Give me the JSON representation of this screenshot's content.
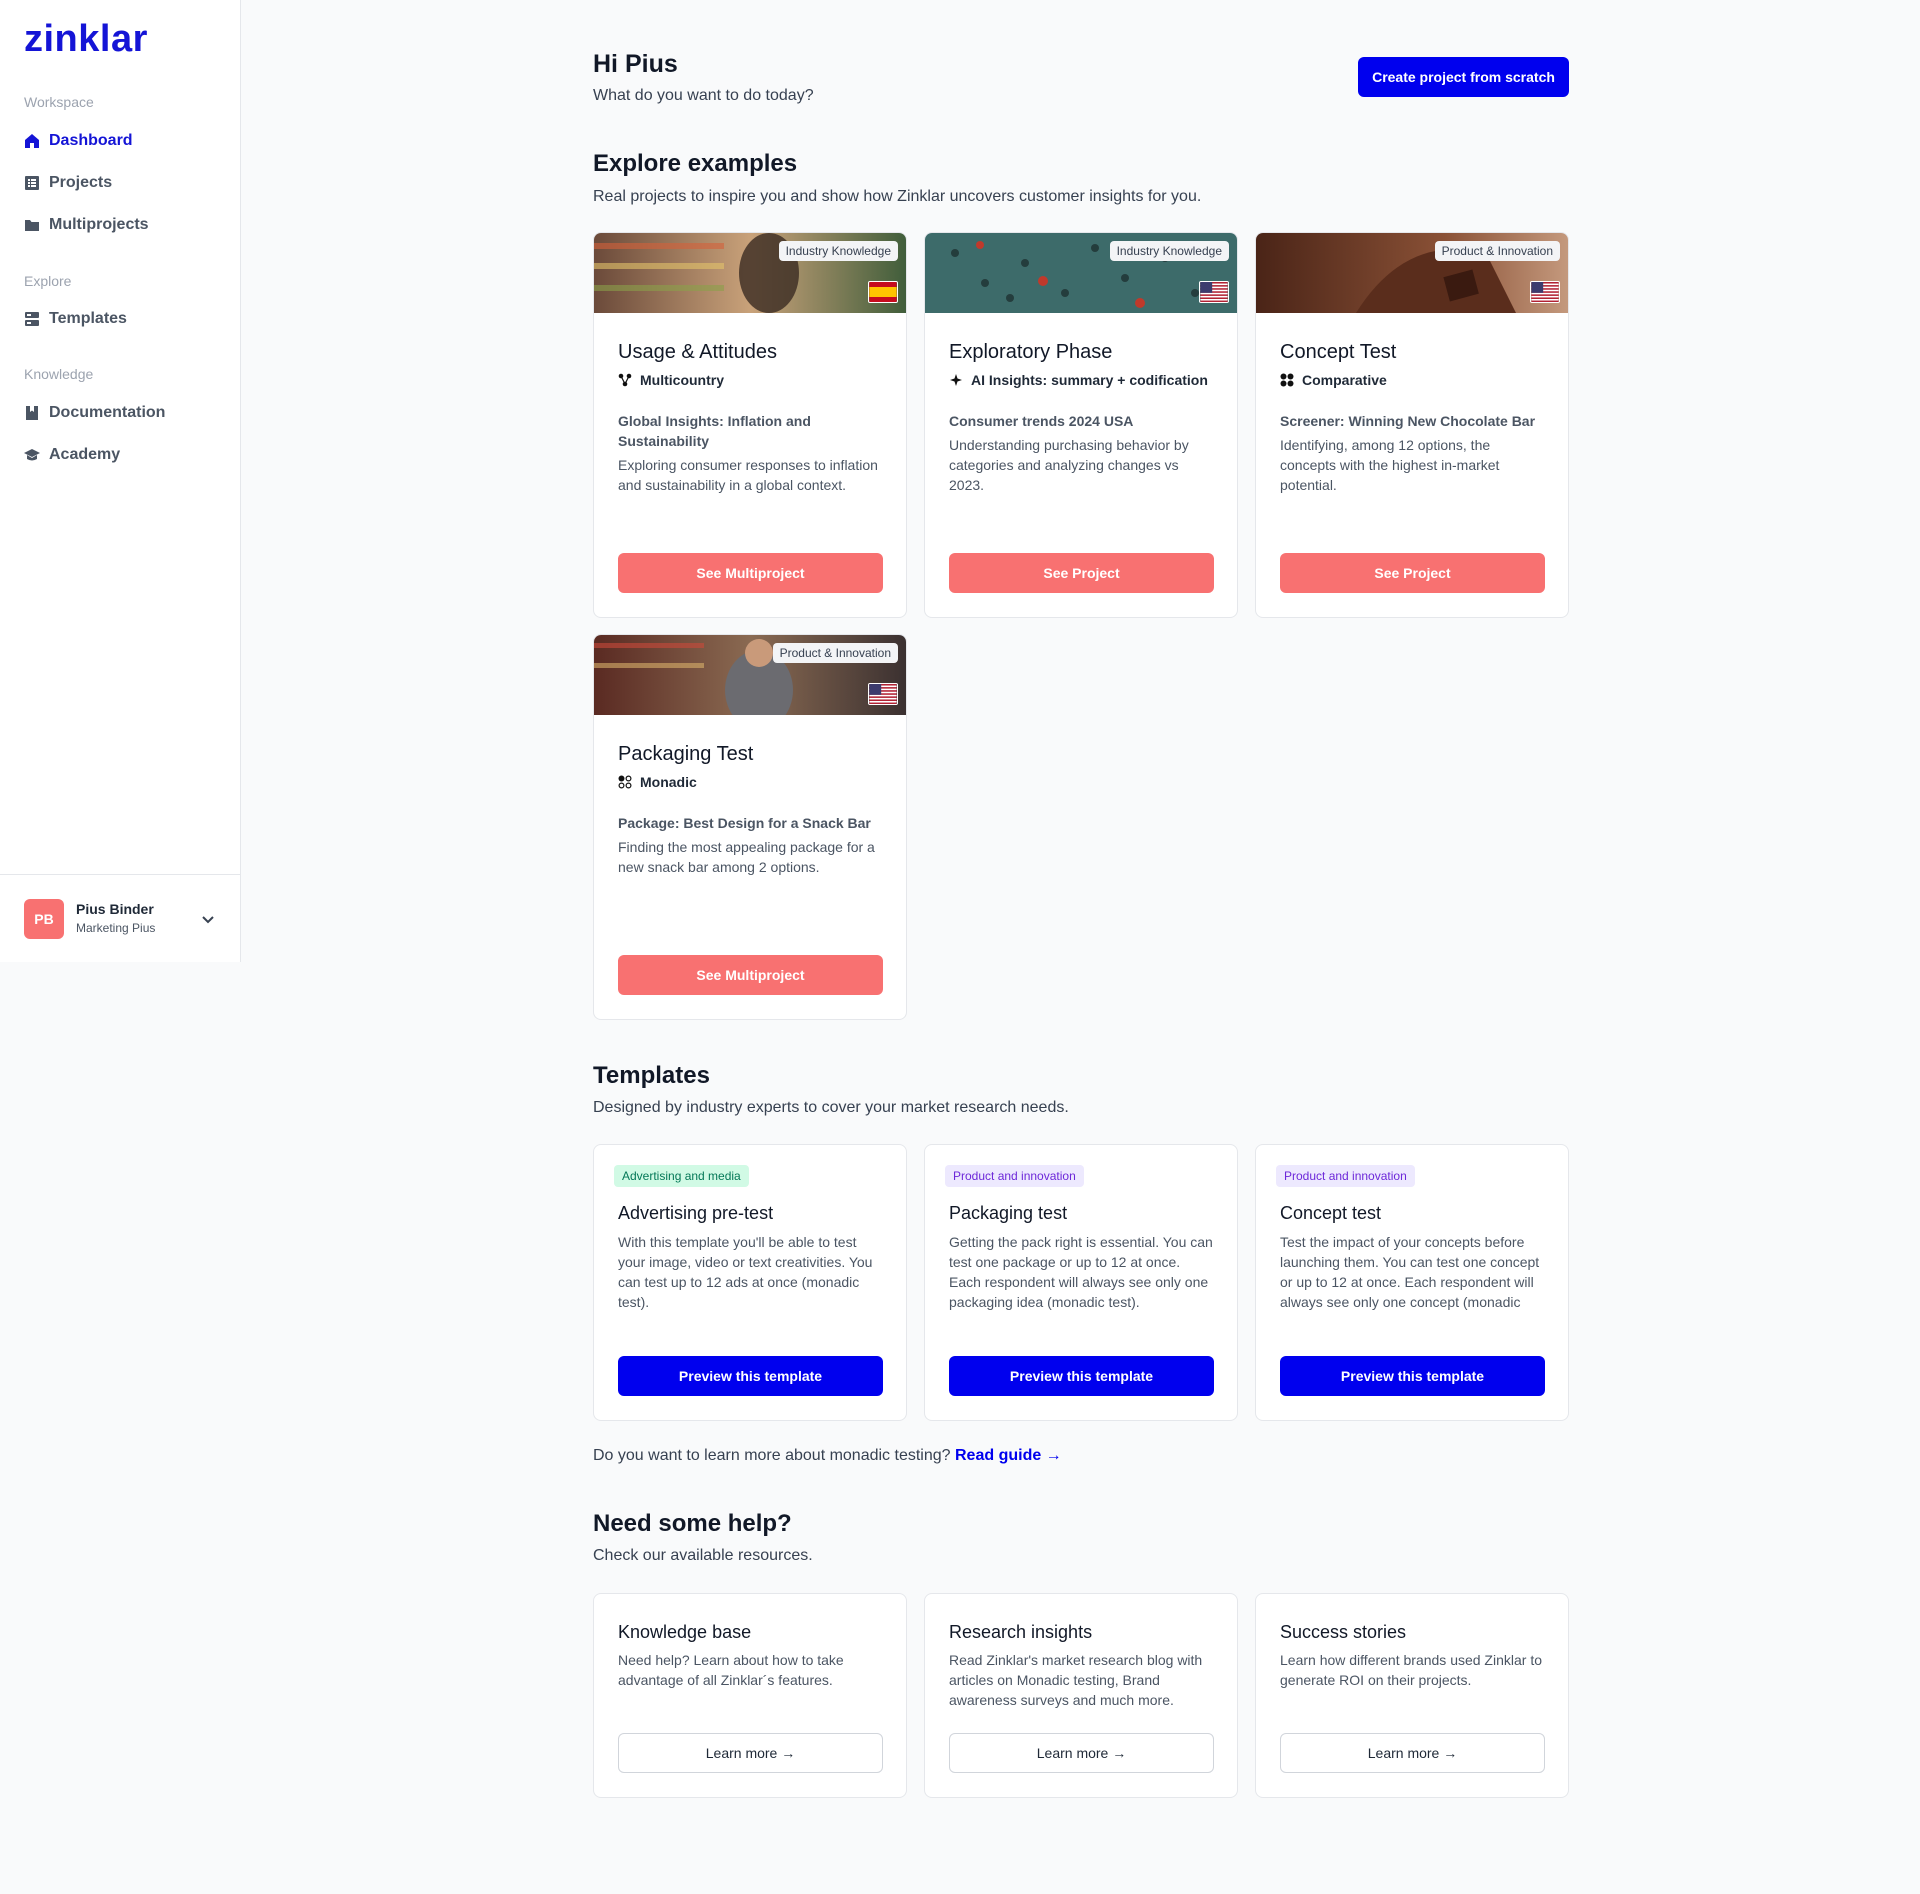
{
  "sidebar": {
    "logo": "zinklar",
    "sections": {
      "workspace": "Workspace",
      "explore": "Explore",
      "knowledge": "Knowledge"
    },
    "items": [
      {
        "label": "Dashboard",
        "icon": "home-icon",
        "active": true
      },
      {
        "label": "Projects",
        "icon": "projects-icon"
      },
      {
        "label": "Multiprojects",
        "icon": "folder-icon"
      },
      {
        "label": "Templates",
        "icon": "templates-icon"
      },
      {
        "label": "Documentation",
        "icon": "book-icon"
      },
      {
        "label": "Academy",
        "icon": "graduation-cap-icon"
      }
    ],
    "user": {
      "initials": "PB",
      "name": "Pius Binder",
      "role": "Marketing Pius"
    }
  },
  "header": {
    "title": "Hi Pius",
    "subtitle": "What do you want to do today?",
    "create_button": "Create project from scratch"
  },
  "explore": {
    "title": "Explore examples",
    "subtitle": "Real projects to inspire you and show how Zinklar uncovers customer insights for you.",
    "cards": [
      {
        "tag": "Industry Knowledge",
        "flag": "spain",
        "title": "Usage & Attitudes",
        "meta": "Multicountry",
        "project": "Global Insights: Inflation and Sustainability",
        "desc": "Exploring consumer responses to inflation and sustainability in a global context.",
        "button": "See Multiproject"
      },
      {
        "tag": "Industry Knowledge",
        "flag": "usa",
        "title": "Exploratory Phase",
        "meta": "AI Insights: summary + codification",
        "project": "Consumer trends 2024 USA",
        "desc": "Understanding purchasing behavior by categories and analyzing changes vs 2023.",
        "button": "See Project"
      },
      {
        "tag": "Product & Innovation",
        "flag": "usa",
        "title": "Concept Test",
        "meta": "Comparative",
        "project": "Screener: Winning New Chocolate Bar",
        "desc": "Identifying, among 12 options, the concepts with the highest in-market potential.",
        "button": "See Project"
      },
      {
        "tag": "Product & Innovation",
        "flag": "usa",
        "title": "Packaging Test",
        "meta": "Monadic",
        "project": "Package: Best Design for a Snack Bar",
        "desc": "Finding the most appealing package for a new snack bar among 2 options.",
        "button": "See Multiproject"
      }
    ]
  },
  "templates": {
    "title": "Templates",
    "subtitle": "Designed by industry experts to cover your market research needs.",
    "cards": [
      {
        "badge": "Advertising and media",
        "title": "Advertising pre-test",
        "desc": "With this template you'll be able to test your image, video or text creativities. You can test up to 12 ads at once (monadic test).",
        "button": "Preview this template"
      },
      {
        "badge": "Product and innovation",
        "title": "Packaging test",
        "desc": "Getting the pack right is essential. You can test one package or up to 12 at once. Each respondent will always see only one packaging idea (monadic test).",
        "button": "Preview this template"
      },
      {
        "badge": "Product and innovation",
        "title": "Concept test",
        "desc": "Test the impact of your concepts before launching them. You can test one concept or up to 12 at once. Each respondent will always see only one concept (monadic",
        "button": "Preview this template"
      }
    ],
    "learn_prompt": "Do you want to learn more about monadic testing?",
    "read_guide": "Read guide →"
  },
  "help": {
    "title": "Need some help?",
    "subtitle": "Check our available resources.",
    "cards": [
      {
        "title": "Knowledge base",
        "desc": "Need help? Learn about how to take advantage of all Zinklar´s features.",
        "button": "Learn more →"
      },
      {
        "title": "Research insights",
        "desc": "Read Zinklar's market research blog with articles on Monadic testing, Brand awareness surveys and much more.",
        "button": "Learn more →"
      },
      {
        "title": "Success stories",
        "desc": "Learn how different brands used Zinklar to generate ROI on their projects.",
        "button": "Learn more →"
      }
    ]
  }
}
